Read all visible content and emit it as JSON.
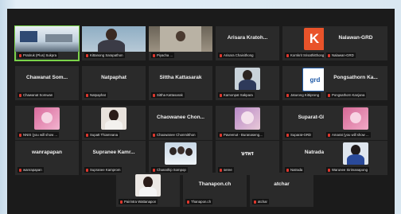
{
  "tiles": [
    {
      "name": "Pratiruk (Plus) Sukpra",
      "big": "",
      "muted": true,
      "active": true,
      "kind": "screen-room"
    },
    {
      "name": "Kittanong Sarapathon",
      "big": "",
      "muted": true,
      "kind": "video-woman"
    },
    {
      "name": "Piyacha ...",
      "big": "",
      "muted": true,
      "kind": "video-man"
    },
    {
      "name": "Arisara Chaisithong",
      "big": "Arisara Kratoh...",
      "muted": true,
      "kind": "name"
    },
    {
      "name": "Kornkrit Srisathitthong",
      "big": "",
      "muted": true,
      "kind": "logo-k",
      "logo": "K"
    },
    {
      "name": "Nalawan-GRD",
      "big": "Nalawan-GRD",
      "muted": true,
      "kind": "name"
    },
    {
      "name": "Chawanat Somwan",
      "big": "Chawanat Som...",
      "muted": true,
      "kind": "name"
    },
    {
      "name": "Natpaphat",
      "big": "Natpaphat",
      "muted": true,
      "kind": "name"
    },
    {
      "name": "Sittha Kattasarak",
      "big": "Sittha Kattasarak",
      "muted": true,
      "kind": "name"
    },
    {
      "name": "Kamonpat Sakpara",
      "big": "",
      "muted": true,
      "kind": "avatar-man"
    },
    {
      "name": "Jaturong Kittiprong",
      "big": "",
      "muted": true,
      "kind": "logo-grd",
      "logo": "grd"
    },
    {
      "name": "Pongsathorn Kanjana",
      "big": "Pongsathorn Ka...",
      "muted": true,
      "kind": "name"
    },
    {
      "name": "NNIS (you will show ...",
      "big": "",
      "muted": true,
      "kind": "avatar-pink"
    },
    {
      "name": "Supatt Thiamnana",
      "big": "",
      "muted": true,
      "kind": "avatar-woman"
    },
    {
      "name": "Chaowanee Chonmitthon",
      "big": "Chaowanee Chon...",
      "muted": true,
      "kind": "name"
    },
    {
      "name": "Paveenut - Buranaseng...",
      "big": "",
      "muted": true,
      "kind": "avatar-flower"
    },
    {
      "name": "Suparat-GRD",
      "big": "Suparat-GRD",
      "muted": true,
      "kind": "name"
    },
    {
      "name": "Amarat (you will show ...",
      "big": "",
      "muted": true,
      "kind": "avatar-pink"
    },
    {
      "name": "wanrapapan",
      "big": "wanrapapan",
      "muted": true,
      "kind": "name"
    },
    {
      "name": "Supranee Kamprom",
      "big": "Supranee Kamr...",
      "muted": true,
      "kind": "name"
    },
    {
      "name": "Chanathip Sompop",
      "big": "",
      "muted": true,
      "kind": "avatar-group"
    },
    {
      "name": "seree",
      "big": "ษรพร",
      "muted": true,
      "kind": "name"
    },
    {
      "name": "Natrada",
      "big": "Natrada",
      "muted": true,
      "kind": "name"
    },
    {
      "name": "Warunee Sirimanapong",
      "big": "",
      "muted": true,
      "kind": "avatar-blue"
    },
    {
      "name": "Pairintra Wattanapon",
      "big": "",
      "muted": true,
      "kind": "avatar-woman2"
    },
    {
      "name": "Thanapon.ch",
      "big": "Thanapon.ch",
      "muted": true,
      "kind": "name"
    },
    {
      "name": "atchar",
      "big": "atchar",
      "muted": true,
      "kind": "name"
    }
  ],
  "colors": {
    "accent": "#7ad34a",
    "muted_mic": "#e0382e",
    "tile_bg": "#2a2a2a"
  }
}
